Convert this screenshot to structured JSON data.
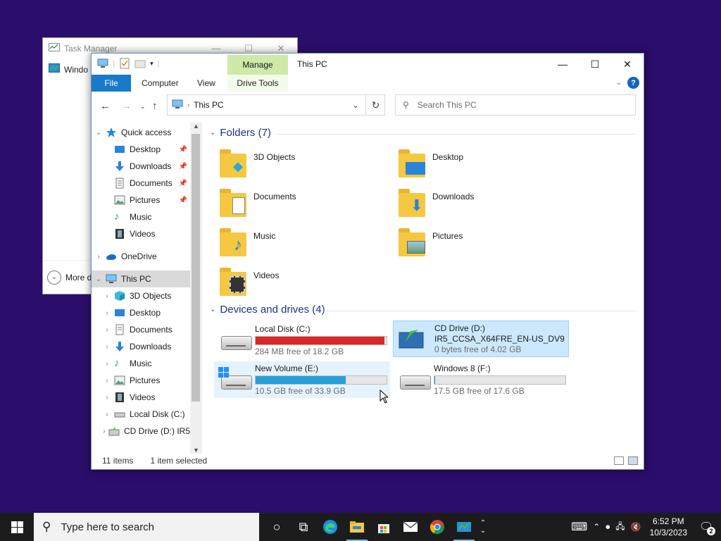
{
  "task_manager": {
    "title": "Task Manager",
    "row_label": "Windo",
    "more_label": "More d"
  },
  "explorer": {
    "manage_label": "Manage",
    "window_title": "This PC",
    "ribbon": {
      "file": "File",
      "computer": "Computer",
      "view": "View",
      "drive_tools": "Drive Tools"
    },
    "address": "This PC",
    "search_placeholder": "Search This PC",
    "nav": {
      "quick_access": "Quick access",
      "qa_items": [
        "Desktop",
        "Downloads",
        "Documents",
        "Pictures",
        "Music",
        "Videos"
      ],
      "onedrive": "OneDrive",
      "this_pc": "This PC",
      "pc_items": [
        "3D Objects",
        "Desktop",
        "Documents",
        "Downloads",
        "Music",
        "Pictures",
        "Videos",
        "Local Disk (C:)",
        "CD Drive (D:) IR5"
      ]
    },
    "folders_header": "Folders (7)",
    "folders": [
      "3D Objects",
      "Desktop",
      "Documents",
      "Downloads",
      "Music",
      "Pictures",
      "Videos"
    ],
    "devices_header": "Devices and drives (4)",
    "drives": [
      {
        "name": "Local Disk (C:)",
        "sub": "284 MB free of 18.2 GB",
        "used_fraction": 0.985,
        "bar_color": "#da2626"
      },
      {
        "name": "CD Drive (D:)",
        "label": "IR5_CCSA_X64FRE_EN-US_DV9",
        "sub": "0 bytes free of 4.02 GB"
      },
      {
        "name": "New Volume (E:)",
        "sub": "10.5 GB free of 33.9 GB",
        "used_fraction": 0.69,
        "bar_color": "#26a0da"
      },
      {
        "name": "Windows 8 (F:)",
        "sub": "17.5 GB free of 17.6 GB",
        "used_fraction": 0.006,
        "bar_color": "#26a0da"
      }
    ],
    "status": {
      "items": "11 items",
      "selected": "1 item selected"
    }
  },
  "taskbar": {
    "search_placeholder": "Type here to search",
    "time": "6:52 PM",
    "date": "10/3/2023",
    "notification_count": "2"
  }
}
